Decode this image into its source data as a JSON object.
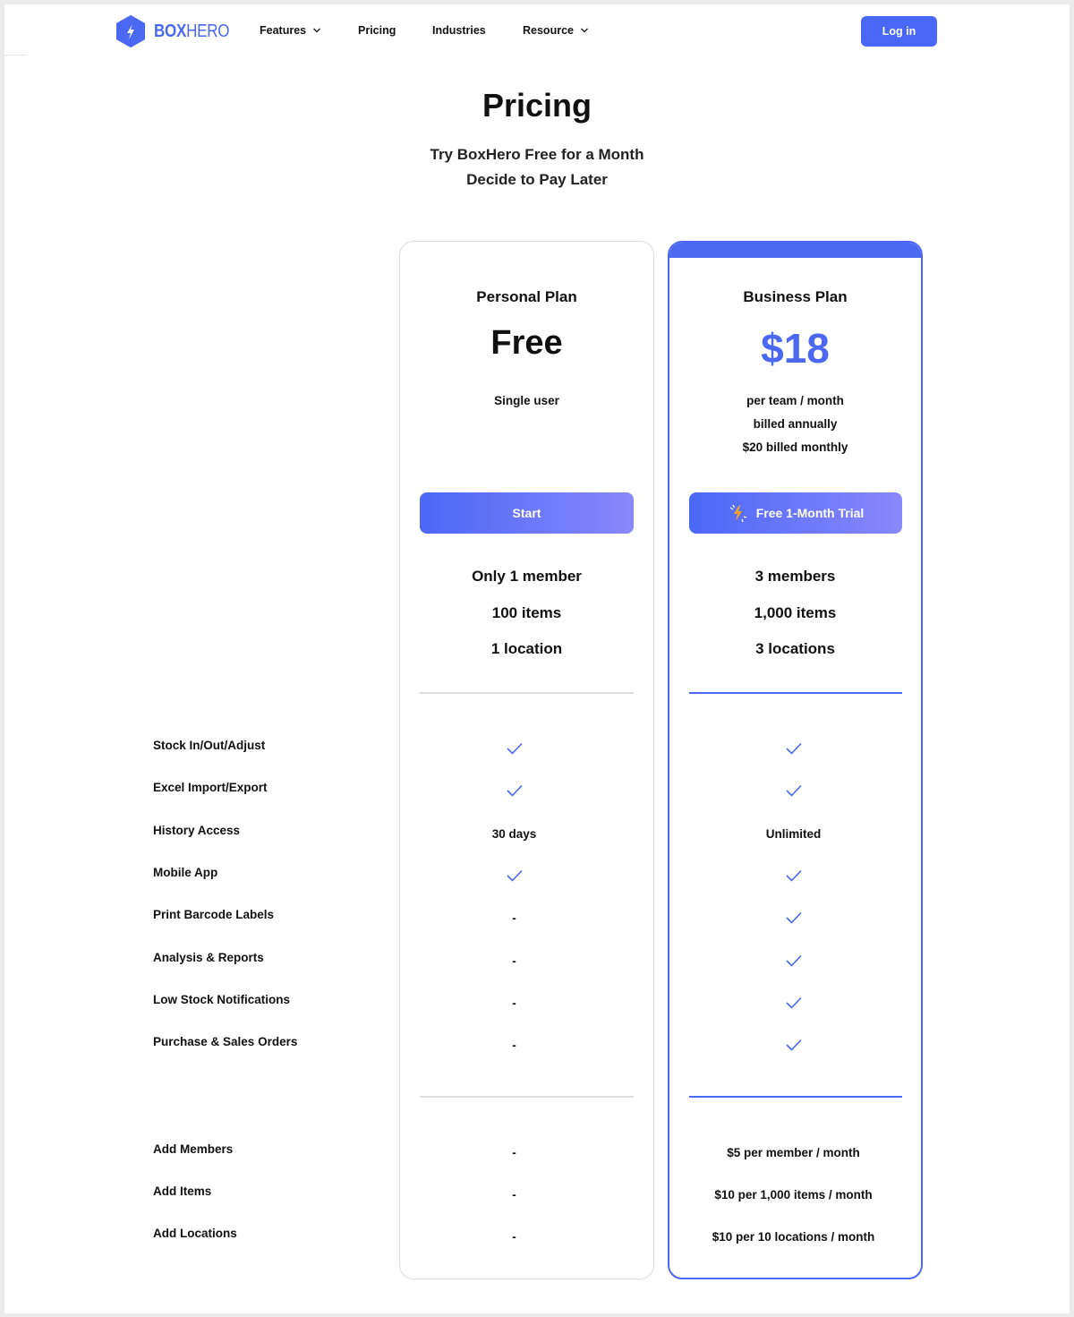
{
  "brand": {
    "name_bold": "BOX",
    "name_light": "HERO",
    "accent": "#4a68f2"
  },
  "nav": {
    "items": [
      {
        "label": "Features",
        "dropdown": true
      },
      {
        "label": "Pricing",
        "dropdown": false
      },
      {
        "label": "Industries",
        "dropdown": false
      },
      {
        "label": "Resource",
        "dropdown": true
      }
    ],
    "login_label": "Log in"
  },
  "header": {
    "title": "Pricing",
    "subtitle_line1": "Try BoxHero Free for a Month",
    "subtitle_line2": "Decide to Pay Later"
  },
  "plans": [
    {
      "name": "Personal Plan",
      "price": "Free",
      "notes": [
        "Single user"
      ],
      "cta": "Start",
      "limits": [
        "Only 1 member",
        "100 items",
        "1 location"
      ],
      "features": [
        "check",
        "check",
        "30 days",
        "check",
        "-",
        "-",
        "-",
        "-"
      ],
      "addons": [
        "-",
        "-",
        "-"
      ]
    },
    {
      "name": "Business Plan",
      "price": "$18",
      "notes": [
        "per team / month",
        "billed annually",
        "$20 billed monthly"
      ],
      "cta": "Free 1-Month Trial",
      "cta_icon": "lightning-icon",
      "limits": [
        "3 members",
        "1,000 items",
        "3 locations"
      ],
      "features": [
        "check",
        "check",
        "Unlimited",
        "check",
        "check",
        "check",
        "check",
        "check"
      ],
      "addons": [
        "$5 per member / month",
        "$10 per 1,000 items / month",
        "$10 per 10 locations / month"
      ]
    }
  ],
  "feature_labels": [
    "Stock In/Out/Adjust",
    "Excel Import/Export",
    "History Access",
    "Mobile App",
    "Print Barcode Labels",
    "Analysis & Reports",
    "Low Stock Notifications",
    "Purchase & Sales Orders"
  ],
  "addon_labels": [
    "Add Members",
    "Add Items",
    "Add Locations"
  ]
}
